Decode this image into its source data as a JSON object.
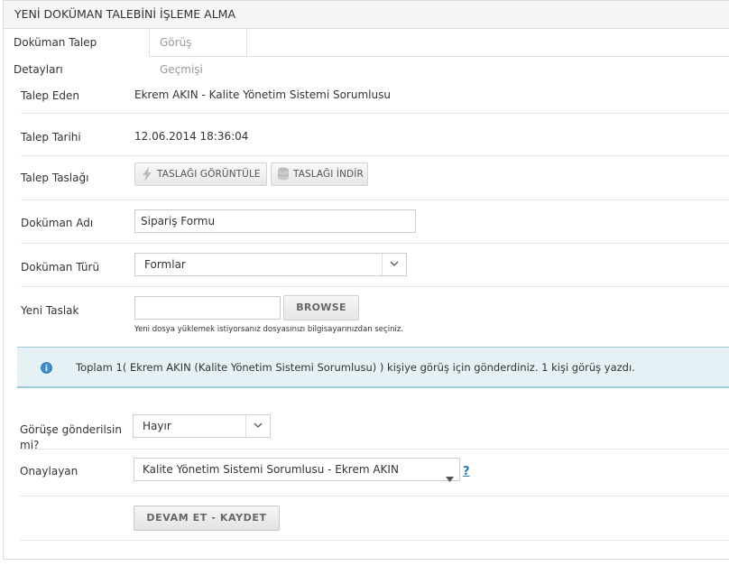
{
  "header": {
    "title": "YENİ DOKÜMAN TALEBİNİ İŞLEME ALMA"
  },
  "tabs": [
    {
      "label": "Doküman Talep Detayları",
      "active": true
    },
    {
      "label": "Görüş Geçmişi",
      "active": false
    }
  ],
  "form": {
    "requester": {
      "label": "Talep Eden",
      "value": "Ekrem AKIN - Kalite Yönetim Sistemi Sorumlusu"
    },
    "request_date": {
      "label": "Talep Tarihi",
      "value": "12.06.2014 18:36:04"
    },
    "draft": {
      "label": "Talep Taslağı",
      "view_button": "TASLAĞI GÖRÜNTÜLE",
      "download_button": "TASLAĞI İNDİR"
    },
    "doc_name": {
      "label": "Doküman Adı",
      "value": "Sipariş Formu"
    },
    "doc_type": {
      "label": "Doküman Türü",
      "value": "Formlar"
    },
    "new_draft": {
      "label": "Yeni Taslak",
      "file_value": "",
      "browse_button": "BROWSE",
      "hint": "Yeni dosya yüklemek istiyorsanız dosyasınızı bilgisayarınızdan seçiniz."
    },
    "info_message": "Toplam 1( Ekrem AKIN (Kalite Yönetim Sistemi Sorumlusu) ) kişiye görüş için gönderdiniz. 1 kişi görüş yazdı.",
    "send_review": {
      "label_line1": "Görüşe gönderilsin",
      "label_line2": "mi?",
      "value": "Hayır"
    },
    "approver": {
      "label": "Onaylayan",
      "value": "Kalite Yönetim Sistemi Sorumlusu - Ekrem AKIN",
      "help": "?"
    },
    "submit_button": "DEVAM ET - KAYDET"
  },
  "colors": {
    "info_background": "#e6f1f5",
    "info_border": "#9fcbd8",
    "info_icon": "#3a8fd0",
    "help_link": "#2a7ab0"
  },
  "icons": {
    "view_button": "lightning-icon",
    "download_button": "database-icon",
    "info": "info-icon",
    "dropdown": "chevron-down-icon",
    "approver_dropdown": "triangle-down-icon"
  }
}
